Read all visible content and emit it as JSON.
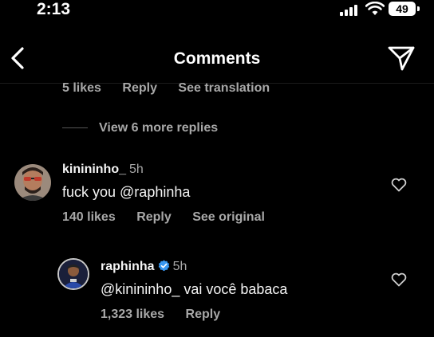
{
  "status": {
    "time": "2:13",
    "battery": "49"
  },
  "nav": {
    "title": "Comments",
    "back_icon": "chevron-left-icon",
    "share_icon": "send-icon"
  },
  "prev_comment_meta": {
    "likes": "5 likes",
    "reply": "Reply",
    "translate": "See translation"
  },
  "view_more": "View 6 more replies",
  "comments": [
    {
      "username": "kinininho_",
      "time": "5h",
      "text": "fuck you @raphinha",
      "likes": "140 likes",
      "reply": "Reply",
      "extra": "See original"
    },
    {
      "username": "raphinha",
      "time": "5h",
      "text": "@kinininho_ vai você babaca",
      "likes": "1,323 likes",
      "reply": "Reply",
      "verified": true
    }
  ],
  "colors": {
    "background": "#000000",
    "secondary_text": "#a8a8a8",
    "verified": "#3897f0"
  }
}
